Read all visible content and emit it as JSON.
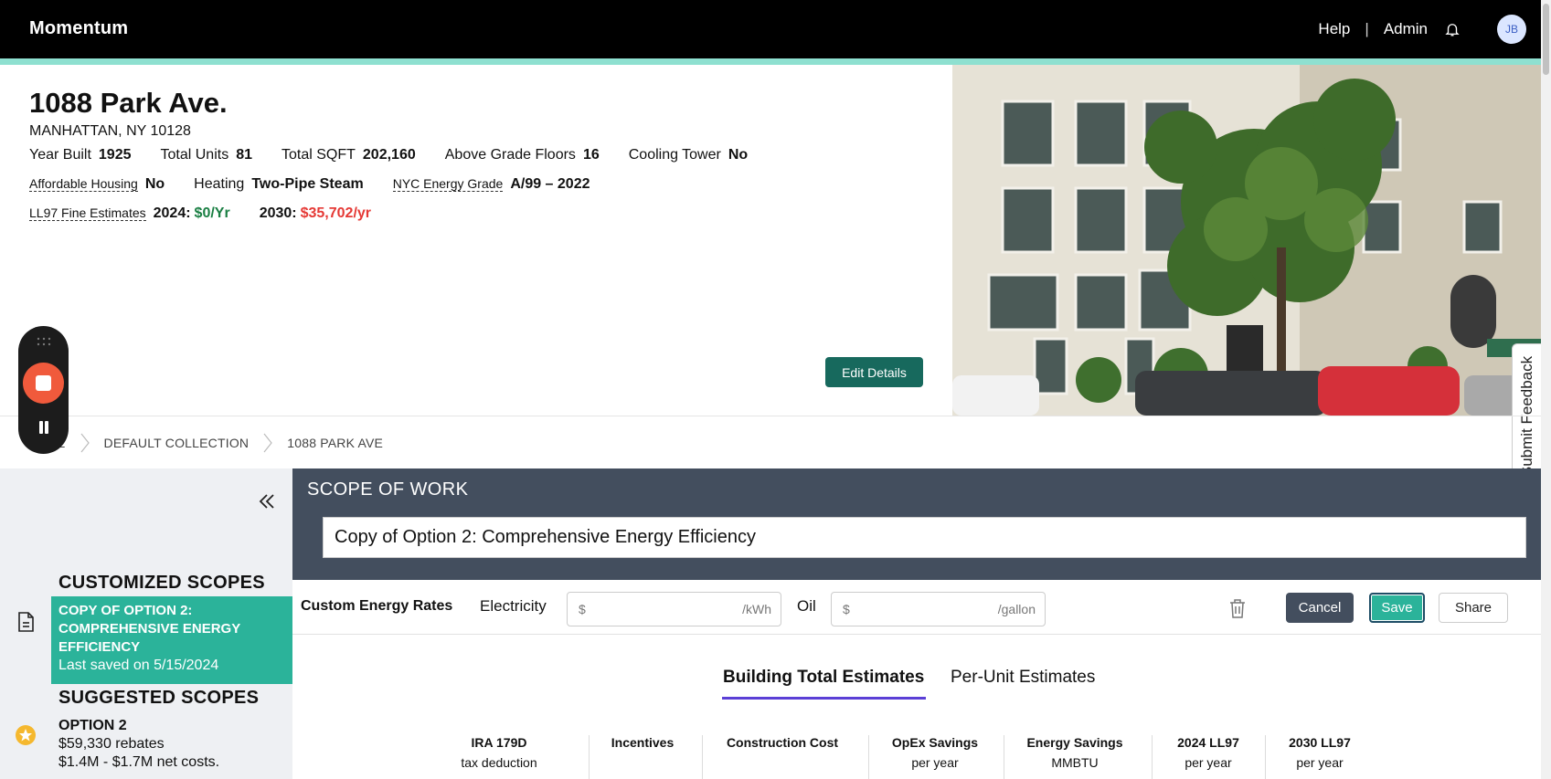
{
  "header": {
    "brand": "Momentum",
    "help": "Help",
    "separator": "|",
    "admin": "Admin",
    "avatar_initials": "JB"
  },
  "building": {
    "title": "1088 Park Ave.",
    "address": "MANHATTAN, NY 10128",
    "row1": [
      {
        "label": "Year Built",
        "value": "1925"
      },
      {
        "label": "Total Units",
        "value": "81"
      },
      {
        "label": "Total SQFT",
        "value": "202,160"
      },
      {
        "label": "Above Grade Floors",
        "value": "16"
      },
      {
        "label": "Cooling Tower",
        "value": "No"
      }
    ],
    "row2": [
      {
        "label": "Affordable Housing",
        "value": "No"
      },
      {
        "label": "Heating",
        "value": "Two-Pipe Steam"
      },
      {
        "label": "NYC Energy Grade",
        "value": "A/99 – 2022"
      }
    ],
    "fines": {
      "label": "LL97 Fine Estimates",
      "y2024_label": "2024:",
      "y2024_value": "$0/Yr",
      "y2030_label": "2030:",
      "y2030_value": "$35,702/yr"
    },
    "edit_button": "Edit Details"
  },
  "feedback_tab": "Submit Feedback",
  "breadcrumb": [
    "E",
    "DEFAULT COLLECTION",
    "1088 PARK AVE"
  ],
  "sidebar": {
    "customized_heading": "CUSTOMIZED SCOPES",
    "active_scope_name": "COPY OF OPTION 2: COMPREHENSIVE ENERGY EFFICIENCY",
    "active_scope_saved": "Last saved on 5/15/2024",
    "suggested_heading": "SUGGESTED SCOPES",
    "option_name": "OPTION 2",
    "option_rebates": "$59,330 rebates",
    "option_costs": "$1.4M - $1.7M net costs."
  },
  "scope": {
    "label": "SCOPE OF WORK",
    "name_value": "Copy of Option 2: Comprehensive Energy Efficiency"
  },
  "rates": {
    "title": "Custom Energy Rates",
    "electricity_label": "Electricity",
    "electricity_prefix": "$",
    "electricity_suffix": "/kWh",
    "oil_label": "Oil",
    "oil_prefix": "$",
    "oil_suffix": "/gallon",
    "cancel": "Cancel",
    "save": "Save",
    "share": "Share"
  },
  "tabs": {
    "building_total": "Building Total Estimates",
    "per_unit": "Per-Unit Estimates"
  },
  "metrics": [
    {
      "title": "IRA 179D",
      "sub": "tax deduction"
    },
    {
      "title": "Incentives",
      "sub": ""
    },
    {
      "title": "Construction Cost",
      "sub": ""
    },
    {
      "title": "OpEx Savings",
      "sub": "per year"
    },
    {
      "title": "Energy Savings",
      "sub": "MMBTU"
    },
    {
      "title": "2024 LL97",
      "sub": "per year"
    },
    {
      "title": "2030 LL97",
      "sub": "per year"
    }
  ],
  "colors": {
    "accent_teal": "#2bb39a",
    "dark_teal": "#17695d",
    "slate": "#434e5e",
    "fine_green": "#1a7f43",
    "fine_red": "#e53935",
    "tab_underline": "#5b3fd6"
  }
}
